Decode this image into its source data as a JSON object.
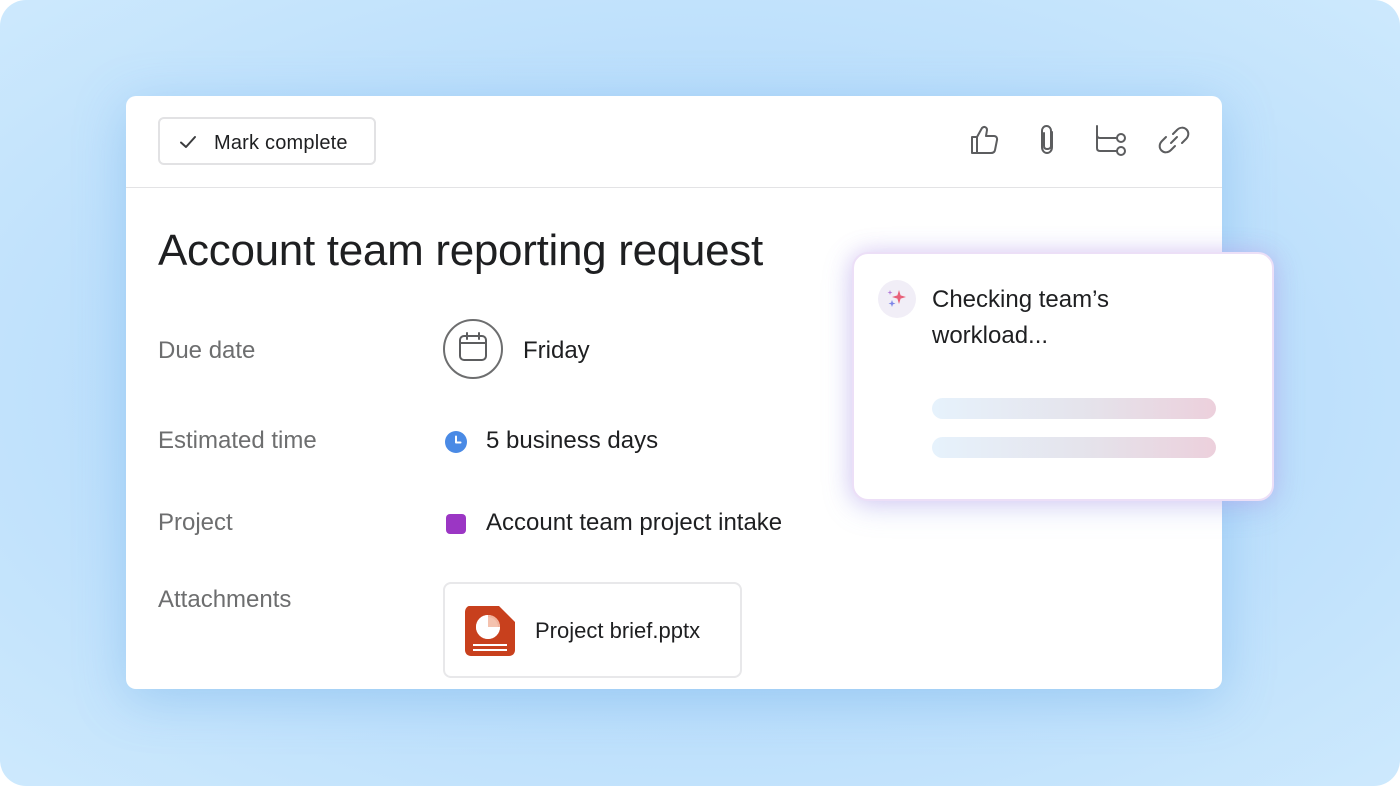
{
  "toolbar": {
    "mark_complete_label": "Mark complete",
    "icons": [
      "thumbs-up-icon",
      "paperclip-icon",
      "subtask-icon",
      "link-icon"
    ]
  },
  "task": {
    "title": "Account team reporting request"
  },
  "fields": {
    "due_date": {
      "label": "Due date",
      "value": "Friday",
      "icon": "calendar-icon"
    },
    "estimated_time": {
      "label": "Estimated time",
      "value": "5 business days",
      "icon": "clock-icon",
      "icon_color": "#4a8ae5"
    },
    "project": {
      "label": "Project",
      "value": "Account team project intake",
      "color": "#9b36c4"
    },
    "attachments": {
      "label": "Attachments",
      "file_name": "Project brief.pptx",
      "file_icon": "powerpoint-file-icon",
      "file_color": "#c8401d"
    }
  },
  "ai_panel": {
    "icon": "sparkle-icon",
    "status_text": "Checking team’s workload..."
  },
  "colors": {
    "background": "#b7dcfb",
    "text_primary": "#1e1f21",
    "text_secondary": "#6d6e6f"
  }
}
